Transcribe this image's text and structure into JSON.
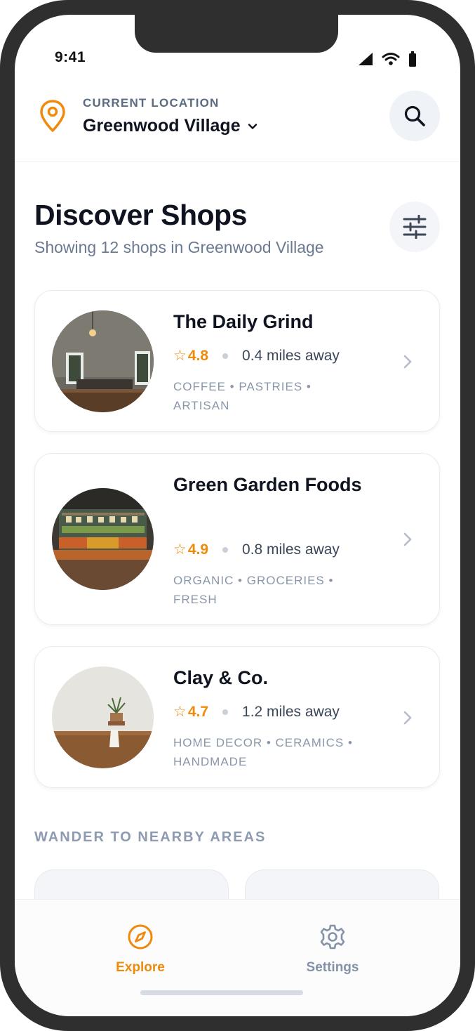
{
  "status_bar": {
    "time": "9:41"
  },
  "header": {
    "location_caption": "CURRENT LOCATION",
    "location_name": "Greenwood Village"
  },
  "page": {
    "title": "Discover Shops",
    "subtitle": "Showing 12 shops in Greenwood Village"
  },
  "shops": [
    {
      "name": "The Daily Grind",
      "rating": "4.8",
      "distance": "0.4 miles away",
      "tags": "COFFEE • PASTRIES • ARTISAN"
    },
    {
      "name": "Green Garden Foods",
      "rating": "4.9",
      "distance": "0.8 miles away",
      "tags": "ORGANIC • GROCERIES • FRESH"
    },
    {
      "name": "Clay & Co.",
      "rating": "4.7",
      "distance": "1.2 miles away",
      "tags": "HOME DECOR • CERAMICS • HANDMADE"
    }
  ],
  "nearby": {
    "label": "WANDER TO NEARBY AREAS"
  },
  "bottom_nav": {
    "explore_label": "Explore",
    "settings_label": "Settings"
  },
  "colors": {
    "accent": "#F08A0C",
    "text_primary": "#0F1420",
    "text_muted": "#8A97AA"
  }
}
